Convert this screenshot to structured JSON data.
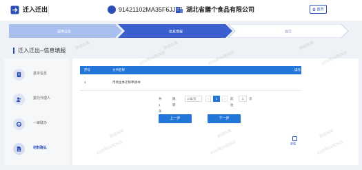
{
  "header": {
    "title": "迁入迁出",
    "credit_code": "91421102MA35F6JJ77",
    "company_name": "湖北省膳个食品有限公司",
    "home_label": "首页"
  },
  "steps": [
    {
      "label": "选择业务",
      "state": "done"
    },
    {
      "label": "信息填报",
      "state": "active"
    },
    {
      "label": "提交",
      "state": "todo"
    }
  ],
  "section_title": "迁入迁出--信息填报",
  "sidebar": {
    "items": [
      {
        "label": "基本信息",
        "icon": "document-icon",
        "active": false
      },
      {
        "label": "委托代理人",
        "icon": "users-icon",
        "active": false
      },
      {
        "label": "一审联办",
        "icon": "target-icon",
        "active": false
      },
      {
        "label": "材料确认",
        "icon": "file-icon",
        "active": true
      }
    ]
  },
  "table": {
    "headers": [
      "序号",
      "文书名称",
      "操作"
    ],
    "rows": [
      {
        "index": "1",
        "name": "市场主体迁移申请书",
        "action": "查看"
      }
    ]
  },
  "pagination": {
    "total": "共1条",
    "jump_label": "跳转",
    "page_size": "10条/页",
    "prev": "‹",
    "current_page": "1",
    "next": "›",
    "goto_prefix": "前往",
    "goto_value": "1",
    "goto_suffix": "页"
  },
  "buttons": {
    "prev_step": "上一步",
    "next_step": "下一步"
  },
  "watermark": {
    "env": "测试环境",
    "date": "2025年03月28日"
  },
  "colors": {
    "primary": "#2376d8",
    "brand": "#2b4fb6",
    "step_done": "#a9c0ef",
    "step_active": "#3c5fd0"
  }
}
